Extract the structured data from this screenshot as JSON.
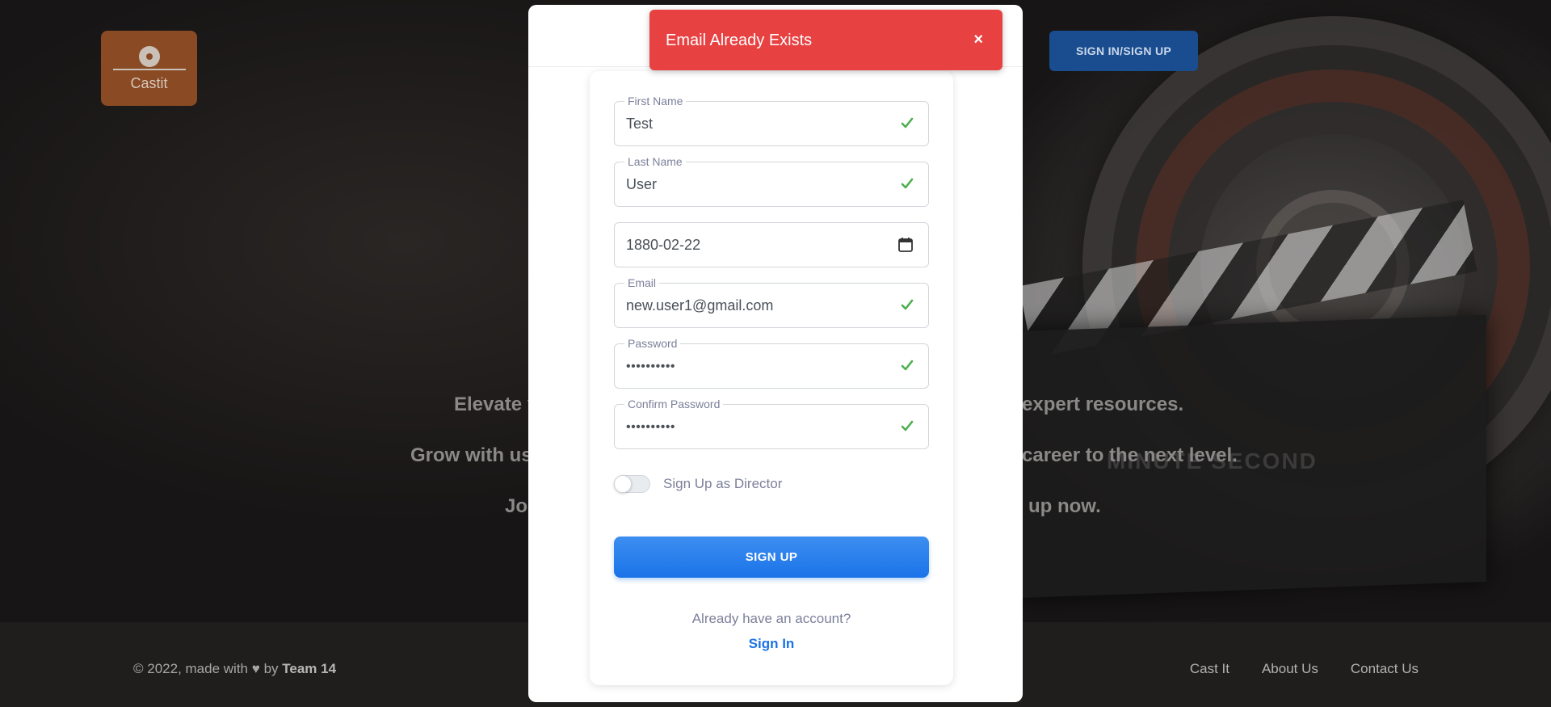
{
  "header": {
    "logo_text": "Castit",
    "signin_button": "SIGN IN/SIGN UP"
  },
  "hero": {
    "line1_left": "Elevate y",
    "line1_right": "expert resources.",
    "line2_left": "Grow with us",
    "line2_right": "career to the next level.",
    "line3_left": "Jo",
    "line3_right": "up now."
  },
  "background": {
    "clapper_text": "MINUTE   SECOND"
  },
  "toast": {
    "message": "Email Already Exists",
    "close": "×"
  },
  "form": {
    "first_name": {
      "label": "First Name",
      "value": "Test"
    },
    "last_name": {
      "label": "Last Name",
      "value": "User"
    },
    "birth_date": {
      "value": "1880-02-22"
    },
    "email": {
      "label": "Email",
      "value": "new.user1@gmail.com"
    },
    "password": {
      "label": "Password",
      "value": "••••••••••"
    },
    "confirm_password": {
      "label": "Confirm Password",
      "value": "••••••••••"
    },
    "director_toggle": {
      "label": "Sign Up as Director",
      "checked": false
    },
    "submit": "SIGN UP",
    "already_text": "Already have an account?",
    "signin_link": "Sign In"
  },
  "footer": {
    "copyright_prefix": "© 2022, made with",
    "copyright_by": "by",
    "team": "Team 14",
    "links": [
      "Cast It",
      "About Us",
      "Contact Us"
    ]
  },
  "colors": {
    "accent": "#1a73e8",
    "success": "#4caf50",
    "toast": "#e84142",
    "logo_bg": "#8a4a24"
  }
}
